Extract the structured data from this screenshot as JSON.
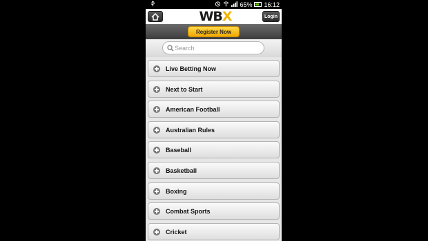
{
  "status_bar": {
    "battery": "65%",
    "time": "16:12"
  },
  "header": {
    "logo_main": "WB",
    "logo_x": "X",
    "login_label": "Login",
    "home_icon": "home-icon"
  },
  "register": {
    "label": "Register Now"
  },
  "search": {
    "placeholder": "Search",
    "value": ""
  },
  "menu": {
    "items": [
      {
        "label": "Live Betting Now"
      },
      {
        "label": "Next to Start"
      },
      {
        "label": "American Football"
      },
      {
        "label": "Australian Rules"
      },
      {
        "label": "Baseball"
      },
      {
        "label": "Basketball"
      },
      {
        "label": "Boxing"
      },
      {
        "label": "Combat Sports"
      },
      {
        "label": "Cricket"
      }
    ]
  },
  "colors": {
    "accent": "#f2b400",
    "header_dark": "#3c3c3c",
    "page_bg": "#e6e6e6"
  }
}
